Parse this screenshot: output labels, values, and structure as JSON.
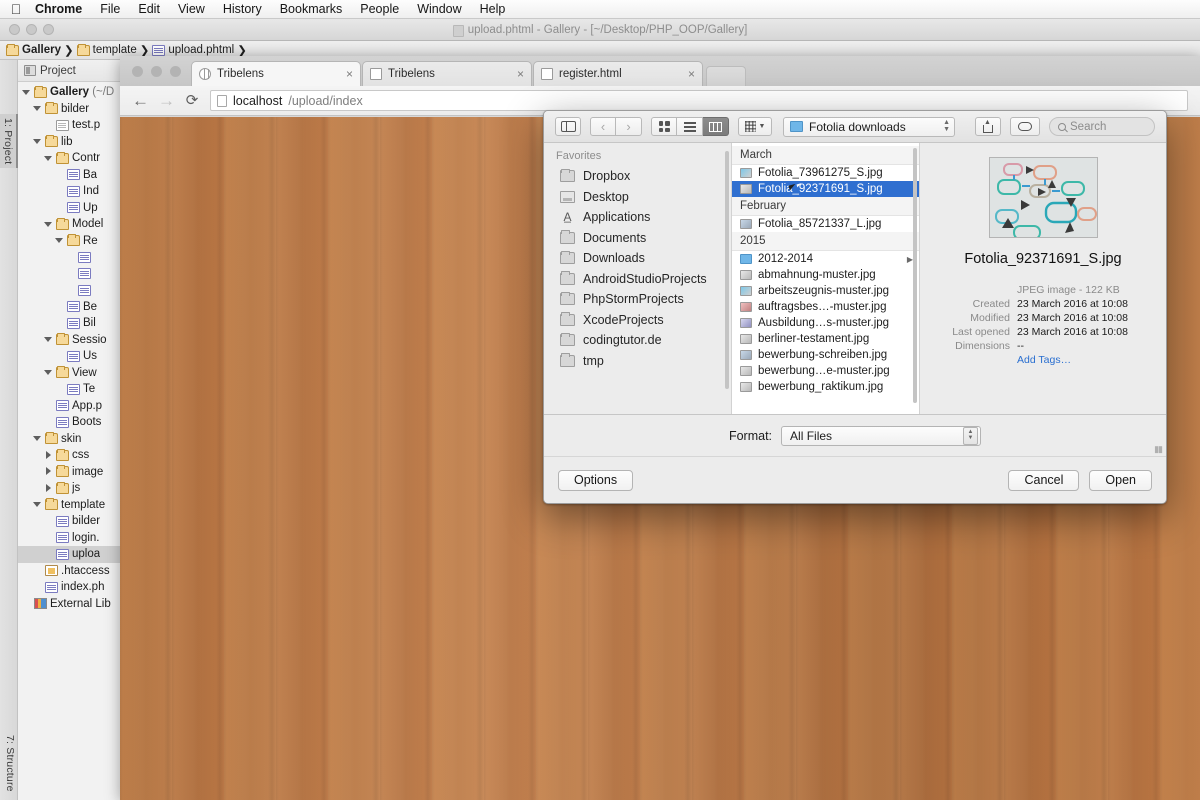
{
  "menubar": {
    "apple": "apple-logo",
    "items": [
      "Chrome",
      "File",
      "Edit",
      "View",
      "History",
      "Bookmarks",
      "People",
      "Window",
      "Help"
    ]
  },
  "ide": {
    "title": "upload.phtml - Gallery - [~/Desktop/PHP_OOP/Gallery]",
    "breadcrumb": [
      "Gallery",
      "template",
      "upload.phtml"
    ],
    "left_tabs": [
      "1: Project",
      "7: Structure"
    ],
    "panel_title": "Project",
    "tree": [
      {
        "label": "Gallery",
        "suffix": "(~/D",
        "depth": 0,
        "twisty": "down",
        "icon": "folder",
        "bold": true
      },
      {
        "label": "bilder",
        "suffix": "",
        "depth": 1,
        "twisty": "down",
        "icon": "folder",
        "bold": false
      },
      {
        "label": "test.p",
        "suffix": "",
        "depth": 2,
        "twisty": "none",
        "icon": "file",
        "bold": false
      },
      {
        "label": "lib",
        "suffix": "",
        "depth": 1,
        "twisty": "down",
        "icon": "folder",
        "bold": false
      },
      {
        "label": "Contr",
        "suffix": "",
        "depth": 2,
        "twisty": "down",
        "icon": "folder",
        "bold": false
      },
      {
        "label": "Ba",
        "suffix": "",
        "depth": 3,
        "twisty": "none",
        "icon": "php",
        "bold": false
      },
      {
        "label": "Ind",
        "suffix": "",
        "depth": 3,
        "twisty": "none",
        "icon": "php",
        "bold": false
      },
      {
        "label": "Up",
        "suffix": "",
        "depth": 3,
        "twisty": "none",
        "icon": "php",
        "bold": false
      },
      {
        "label": "Model",
        "suffix": "",
        "depth": 2,
        "twisty": "down",
        "icon": "folder",
        "bold": false
      },
      {
        "label": "Re",
        "suffix": "",
        "depth": 3,
        "twisty": "down",
        "icon": "folder",
        "bold": false
      },
      {
        "label": "",
        "suffix": "",
        "depth": 4,
        "twisty": "none",
        "icon": "php",
        "bold": false
      },
      {
        "label": "",
        "suffix": "",
        "depth": 4,
        "twisty": "none",
        "icon": "php",
        "bold": false
      },
      {
        "label": "",
        "suffix": "",
        "depth": 4,
        "twisty": "none",
        "icon": "php",
        "bold": false
      },
      {
        "label": "Be",
        "suffix": "",
        "depth": 3,
        "twisty": "none",
        "icon": "php",
        "bold": false
      },
      {
        "label": "Bil",
        "suffix": "",
        "depth": 3,
        "twisty": "none",
        "icon": "php",
        "bold": false
      },
      {
        "label": "Sessio",
        "suffix": "",
        "depth": 2,
        "twisty": "down",
        "icon": "folder",
        "bold": false
      },
      {
        "label": "Us",
        "suffix": "",
        "depth": 3,
        "twisty": "none",
        "icon": "php",
        "bold": false
      },
      {
        "label": "View",
        "suffix": "",
        "depth": 2,
        "twisty": "down",
        "icon": "folder",
        "bold": false
      },
      {
        "label": "Te",
        "suffix": "",
        "depth": 3,
        "twisty": "none",
        "icon": "php",
        "bold": false
      },
      {
        "label": "App.p",
        "suffix": "",
        "depth": 2,
        "twisty": "none",
        "icon": "php",
        "bold": false
      },
      {
        "label": "Boots",
        "suffix": "",
        "depth": 2,
        "twisty": "none",
        "icon": "php",
        "bold": false
      },
      {
        "label": "skin",
        "suffix": "",
        "depth": 1,
        "twisty": "down",
        "icon": "folder",
        "bold": false
      },
      {
        "label": "css",
        "suffix": "",
        "depth": 2,
        "twisty": "right",
        "icon": "folder",
        "bold": false
      },
      {
        "label": "image",
        "suffix": "",
        "depth": 2,
        "twisty": "right",
        "icon": "folder",
        "bold": false
      },
      {
        "label": "js",
        "suffix": "",
        "depth": 2,
        "twisty": "right",
        "icon": "folder",
        "bold": false
      },
      {
        "label": "template",
        "suffix": "",
        "depth": 1,
        "twisty": "down",
        "icon": "folder",
        "bold": false
      },
      {
        "label": "bilder",
        "suffix": "",
        "depth": 2,
        "twisty": "none",
        "icon": "php",
        "bold": false
      },
      {
        "label": "login.",
        "suffix": "",
        "depth": 2,
        "twisty": "none",
        "icon": "php",
        "bold": false
      },
      {
        "label": "uploa",
        "suffix": "",
        "depth": 2,
        "twisty": "none",
        "icon": "php",
        "bold": false,
        "selected": true
      },
      {
        "label": ".htaccess",
        "suffix": "",
        "depth": 1,
        "twisty": "none",
        "icon": "htaccess",
        "bold": false
      },
      {
        "label": "index.ph",
        "suffix": "",
        "depth": 1,
        "twisty": "none",
        "icon": "php",
        "bold": false
      },
      {
        "label": "External Lib",
        "suffix": "",
        "depth": 0,
        "twisty": "none",
        "icon": "lib",
        "bold": false
      }
    ]
  },
  "browser": {
    "tabs": [
      {
        "title": "Tribelens",
        "favicon": "globe-icon",
        "active": true
      },
      {
        "title": "Tribelens",
        "favicon": "page-icon",
        "active": false
      },
      {
        "title": "register.html",
        "favicon": "page-icon",
        "active": false
      }
    ],
    "close_glyph": "×",
    "back_glyph": "←",
    "forward_glyph": "→",
    "reload_glyph": "⟳",
    "url_host": "localhost",
    "url_path": "/upload/index"
  },
  "dialog": {
    "toolbar": {
      "sidebar_toggle": "sidebar-toggle-icon",
      "back_glyph": "‹",
      "forward_glyph": "›",
      "view_modes": [
        "icon-view",
        "list-view",
        "column-view"
      ],
      "active_view": "column-view",
      "arrange": "arrange-icon",
      "path_label": "Fotolia downloads",
      "share": "share-icon",
      "tag": "tag-icon",
      "search_placeholder": "Search"
    },
    "favorites": {
      "title": "Favorites",
      "items": [
        {
          "label": "Dropbox",
          "icon": "folder"
        },
        {
          "label": "Desktop",
          "icon": "desktop"
        },
        {
          "label": "Applications",
          "icon": "applications"
        },
        {
          "label": "Documents",
          "icon": "folder"
        },
        {
          "label": "Downloads",
          "icon": "folder"
        },
        {
          "label": "AndroidStudioProjects",
          "icon": "folder"
        },
        {
          "label": "PhpStormProjects",
          "icon": "folder"
        },
        {
          "label": "XcodeProjects",
          "icon": "folder"
        },
        {
          "label": "codingtutor.de",
          "icon": "folder"
        },
        {
          "label": "tmp",
          "icon": "folder"
        }
      ]
    },
    "filelist": [
      {
        "type": "group",
        "label": "March"
      },
      {
        "type": "file",
        "label": "Fotolia_73961275_S.jpg",
        "icon": "a",
        "selected": false
      },
      {
        "type": "file",
        "label": "Fotolia_92371691_S.jpg",
        "icon": "b",
        "selected": true
      },
      {
        "type": "group",
        "label": "February"
      },
      {
        "type": "file",
        "label": "Fotolia_85721337_L.jpg",
        "icon": "c",
        "selected": false
      },
      {
        "type": "group",
        "label": "2015"
      },
      {
        "type": "folder",
        "label": "2012-2014",
        "icon": "fold",
        "selected": false,
        "chevron": "▶"
      },
      {
        "type": "file",
        "label": "abmahnung-muster.jpg",
        "icon": "b",
        "selected": false
      },
      {
        "type": "file",
        "label": "arbeitszeugnis-muster.jpg",
        "icon": "a",
        "selected": false
      },
      {
        "type": "file",
        "label": "auftragsbes…-muster.jpg",
        "icon": "d",
        "selected": false
      },
      {
        "type": "file",
        "label": "Ausbildung…s-muster.jpg",
        "icon": "e",
        "selected": false
      },
      {
        "type": "file",
        "label": "berliner-testament.jpg",
        "icon": "b",
        "selected": false
      },
      {
        "type": "file",
        "label": "bewerbung-schreiben.jpg",
        "icon": "c",
        "selected": false
      },
      {
        "type": "file",
        "label": "bewerbung…e-muster.jpg",
        "icon": "b",
        "selected": false
      },
      {
        "type": "file",
        "label": "bewerbung_raktikum.jpg",
        "icon": "b",
        "selected": false
      }
    ],
    "preview": {
      "filename": "Fotolia_92371691_S.jpg",
      "kind_size": "JPEG image - 122 KB",
      "rows": [
        {
          "key": "Created",
          "value": "23 March 2016 at 10:08"
        },
        {
          "key": "Modified",
          "value": "23 March 2016 at 10:08"
        },
        {
          "key": "Last opened",
          "value": "23 March 2016 at 10:08"
        },
        {
          "key": "Dimensions",
          "value": "--"
        }
      ],
      "add_tags": "Add Tags…"
    },
    "format_label": "Format:",
    "format_value": "All Files",
    "options_button": "Options",
    "cancel_button": "Cancel",
    "open_button": "Open"
  },
  "colors": {
    "selection_blue": "#2f6fd0",
    "link_blue": "#2a6fd0",
    "wood": "#bd7a44"
  }
}
